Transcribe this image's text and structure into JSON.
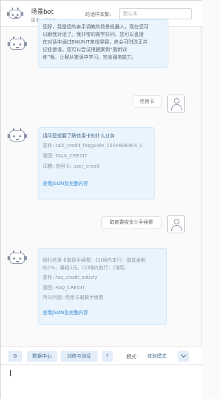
{
  "header": {
    "title": "场景bot",
    "version": "版本: V29.0",
    "select_label": "的话样本集:",
    "select_placeholder": "默认本"
  },
  "messages": [
    {
      "role": "bot",
      "lines": [
        "您好，我是您的亲手调教的场景机器人，现在您可",
        "以跟我对话了。我非常的需学好问，您可以直接",
        "在对话中通过BNUNIT来指导我，房会可时改正并",
        "记住错误。您可以尝试根据案例“重新训",
        "练”我，让我从错误中学习、完善服务能力。"
      ]
    },
    {
      "role": "user",
      "text": "信用卡"
    },
    {
      "role": "bot",
      "lines": [
        "请问您想要了解信用卡的什么业务",
        "",
        "意作: talk_credit_faqguide_1504686904_0",
        "",
        "意图: TALK_CREDIT",
        "",
        "词槽: 信用卡: user_credit",
        "",
        "",
        "查看JSON及完整内容"
      ]
    },
    {
      "role": "user",
      "text": "取款要收多少手续费"
    },
    {
      "role": "bot",
      "lines": [
        "银行信用卡取现手续费：(1)境内本行：取现金额",
        "的1%，最低1元。(2)境内他行：(境现...",
        "",
        "意作: faq_credit_satisfy",
        "",
        "意图: FAQ_CREDIT",
        "",
        "所义问题: 信用卡取款手续费",
        "",
        "",
        "查看JSON及完整内容"
      ]
    }
  ],
  "toolbar": {
    "gear_icon": "gear-icon",
    "data_center": "数据中心",
    "train_verify": "训练与验证",
    "help": "?",
    "mode_label": "模式:",
    "mode_value": "体验模式"
  }
}
